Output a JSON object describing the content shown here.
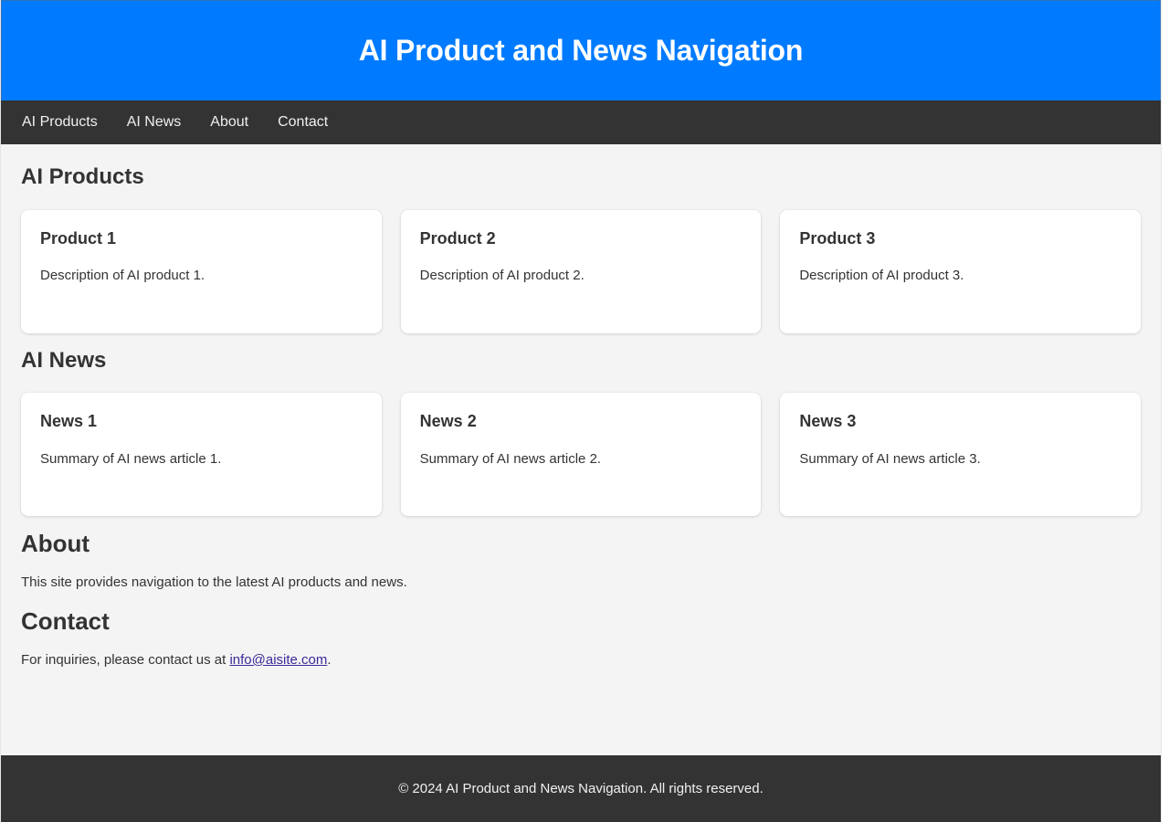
{
  "header": {
    "title": "AI Product and News Navigation",
    "background_color": "#007bff",
    "text_color": "#ffffff"
  },
  "nav": {
    "background_color": "#333333",
    "items": [
      {
        "label": "AI Products"
      },
      {
        "label": "AI News"
      },
      {
        "label": "About"
      },
      {
        "label": "Contact"
      }
    ]
  },
  "main": {
    "products_section": {
      "heading": "AI Products",
      "cards": [
        {
          "title": "Product 1",
          "text": "Description of AI product 1."
        },
        {
          "title": "Product 2",
          "text": "Description of AI product 2."
        },
        {
          "title": "Product 3",
          "text": "Description of AI product 3."
        }
      ]
    },
    "news_section": {
      "heading": "AI News",
      "cards": [
        {
          "title": "News 1",
          "text": "Summary of AI news article 1."
        },
        {
          "title": "News 2",
          "text": "Summary of AI news article 2."
        },
        {
          "title": "News 3",
          "text": "Summary of AI news article 3."
        }
      ]
    },
    "about_section": {
      "heading": "About",
      "text": "This site provides navigation to the latest AI products and news."
    },
    "contact_section": {
      "heading": "Contact",
      "text_before_link": "For inquiries, please contact us at ",
      "email": "info@aisite.com",
      "text_after_link": ".",
      "link_color": "#3b2a9a"
    }
  },
  "footer": {
    "text": "© 2024 AI Product and News Navigation. All rights reserved.",
    "background_color": "#333333"
  }
}
